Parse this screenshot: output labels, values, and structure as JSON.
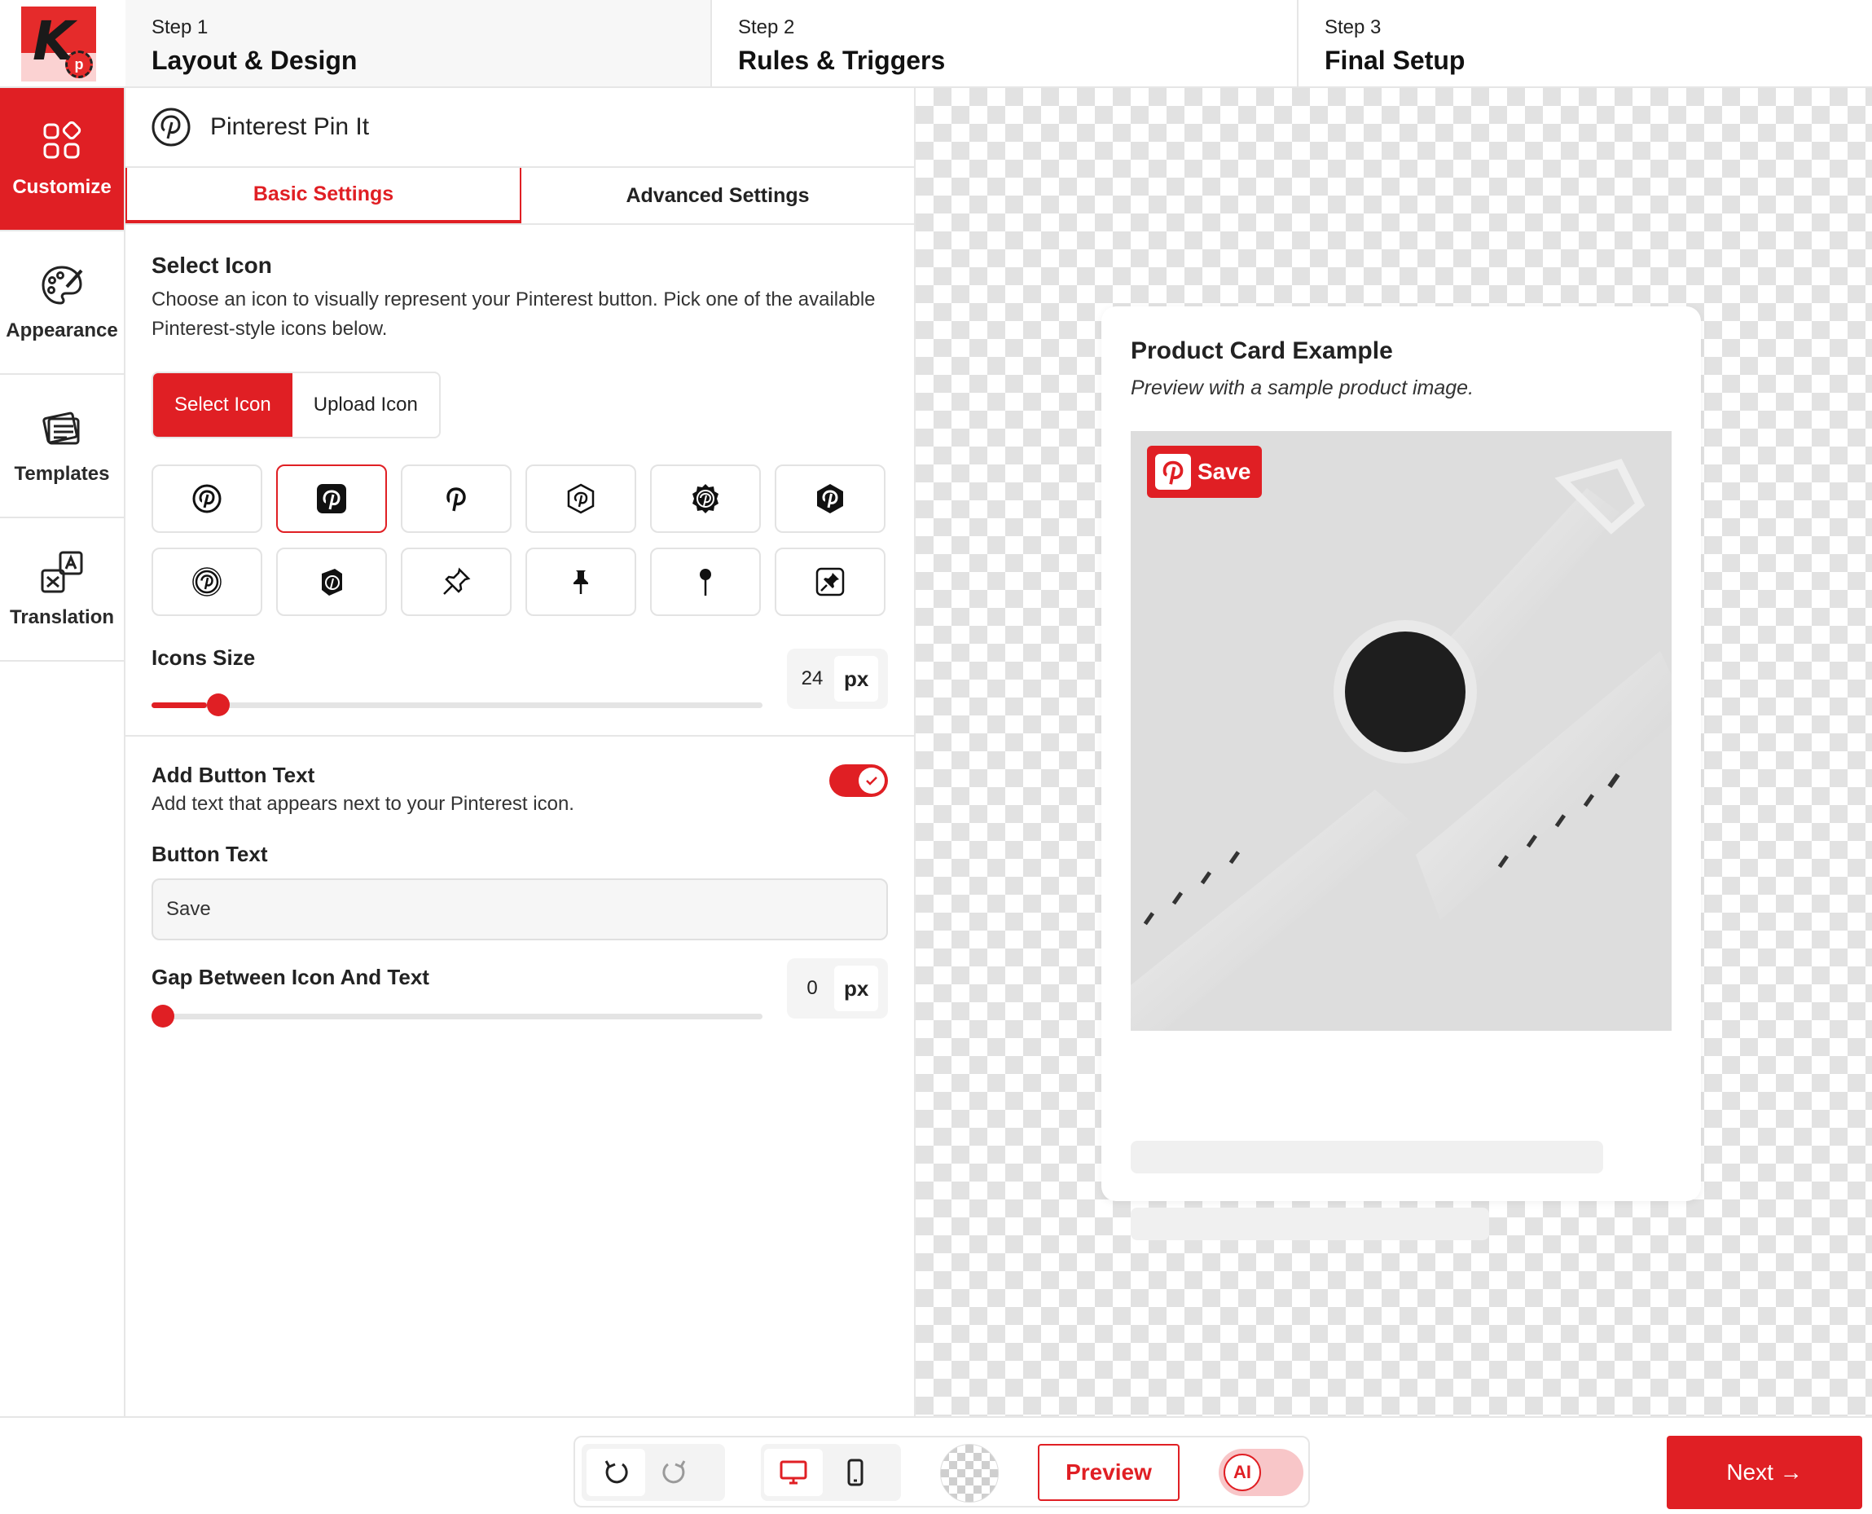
{
  "header": {
    "steps": [
      {
        "num": "Step 1",
        "title": "Layout & Design"
      },
      {
        "num": "Step 2",
        "title": "Rules & Triggers"
      },
      {
        "num": "Step 3",
        "title": "Final Setup"
      }
    ],
    "logo_letter": "K"
  },
  "nav": {
    "items": [
      {
        "label": "Customize",
        "icon": "grid-shapes-icon",
        "active": true
      },
      {
        "label": "Appearance",
        "icon": "palette-icon"
      },
      {
        "label": "Templates",
        "icon": "templates-icon"
      },
      {
        "label": "Translation",
        "icon": "translate-icon"
      }
    ]
  },
  "panel": {
    "title": "Pinterest Pin It",
    "tabs": [
      "Basic Settings",
      "Advanced Settings"
    ],
    "select_icon": {
      "title": "Select Icon",
      "description": "Choose an icon to visually represent your Pinterest button. Pick one of the available Pinterest-style icons below.",
      "options": [
        "Select Icon",
        "Upload Icon"
      ],
      "selected_index": 1
    },
    "icons_size": {
      "label": "Icons Size",
      "value": "24",
      "unit": "px",
      "fraction": 0.09
    },
    "button_text": {
      "title": "Add Button Text",
      "description": "Add text that appears next to your Pinterest icon.",
      "enabled": true,
      "field_label": "Button Text",
      "value": "Save"
    },
    "gap": {
      "label": "Gap Between Icon And Text",
      "value": "0",
      "unit": "px",
      "fraction": 0.0
    }
  },
  "preview": {
    "card_title": "Product Card Example",
    "card_subtitle": "Preview with a sample product image.",
    "save_label": "Save"
  },
  "bottom": {
    "preview_label": "Preview",
    "ai_label": "AI",
    "next_label": "Next →"
  },
  "colors": {
    "accent": "#e01f24"
  }
}
